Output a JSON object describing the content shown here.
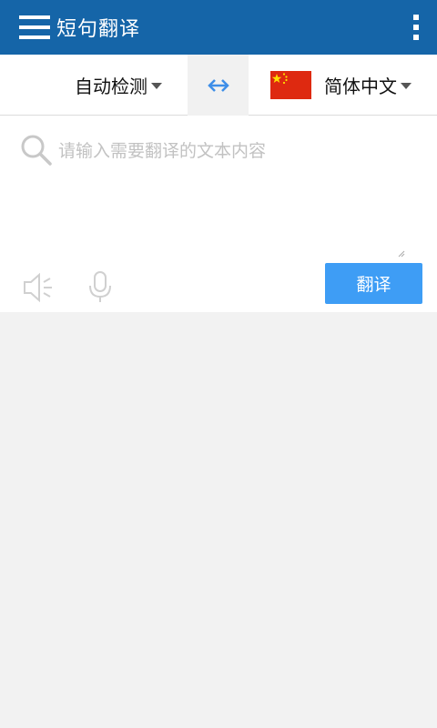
{
  "appbar": {
    "title": "短句翻译",
    "menu_icon": "hamburger-menu-icon",
    "overflow_icon": "more-vertical-icon",
    "background_color": "#1565a8"
  },
  "language_bar": {
    "source_language": "自动检测",
    "swap_icon": "swap-arrows-icon",
    "target_flag": "china-flag-icon",
    "target_language": "简体中文"
  },
  "input": {
    "placeholder": "请输入需要翻译的文本内容",
    "value": ""
  },
  "actions": {
    "speaker_icon": "speaker-icon",
    "mic_icon": "microphone-icon",
    "translate_label": "翻译",
    "translate_color": "#3e9df5"
  }
}
